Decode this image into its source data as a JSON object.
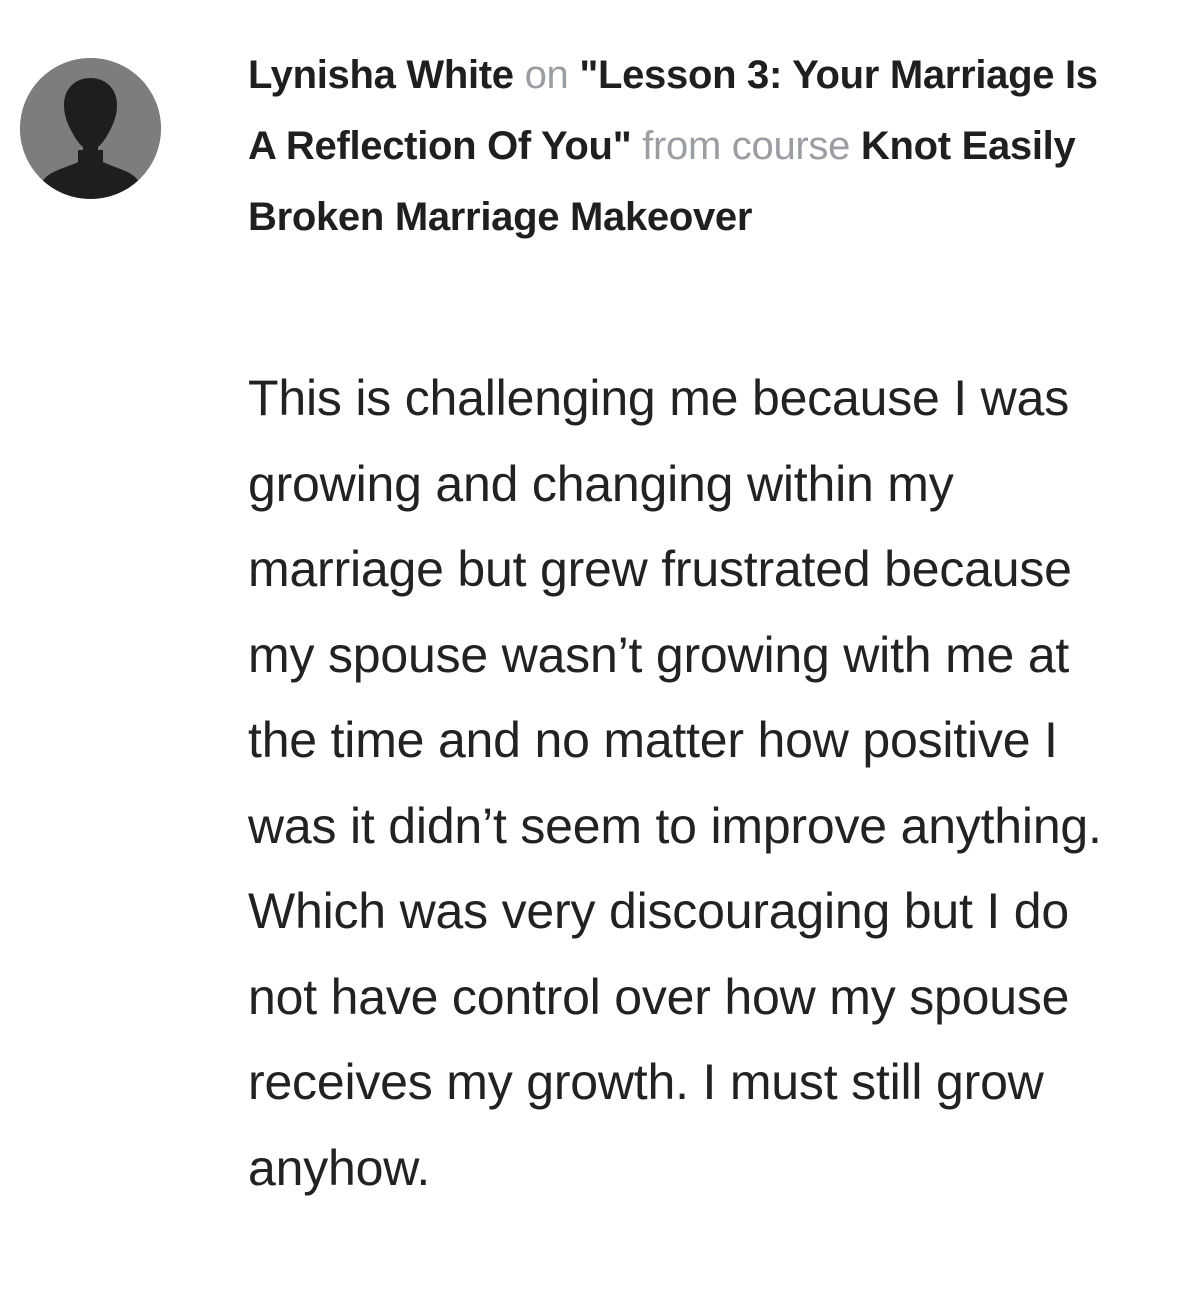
{
  "comment": {
    "author": "Lynisha White",
    "on_text": "on",
    "lesson_title": "\"Lesson 3: Your Marriage Is A Reflection Of You\"",
    "from_text": "from course",
    "course_title": "Knot Easily Broken Marriage Makeover",
    "body": "This is challenging me because I was growing and changing within my marriage but grew frustrated because my spouse wasn’t growing with me at the time and no matter how positive I was it didn’t seem to improve anything. Which was very discouraging but I do not have control over how my spouse receives my growth. I must still grow anyhow.",
    "avatar_icon": "user-silhouette-icon",
    "colors": {
      "avatar_bg": "#7d7d7d",
      "avatar_figure": "#1e1e1e",
      "muted_text": "#9a9ea3",
      "body_text": "#222222"
    }
  }
}
